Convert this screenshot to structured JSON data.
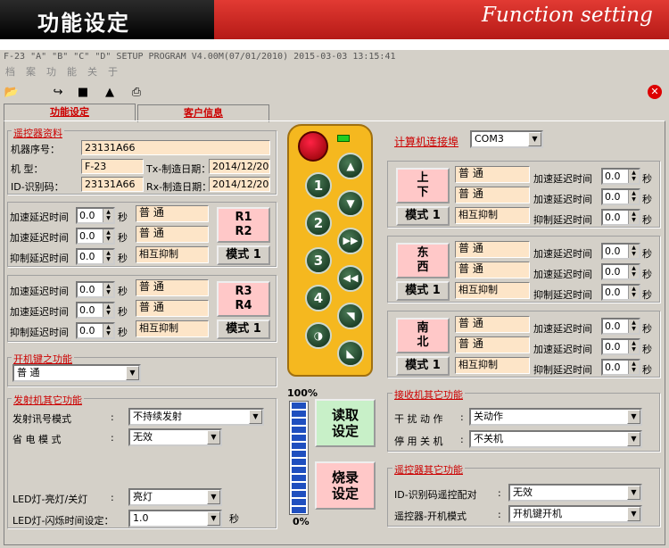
{
  "banner": {
    "title_cn": "功能设定",
    "title_en": "Function setting"
  },
  "window_title": "F-23 \"A\" \"B\" \"C\" \"D\" SETUP PROGRAM V4.00M(07/01/2010)   2015-03-03   13:15:41",
  "menu": [
    "档",
    "案",
    "功",
    "能",
    "关",
    "于"
  ],
  "toolbar_icons": [
    "open-folder-icon",
    "download-icon",
    "save-icon",
    "eject-icon",
    "print-icon",
    "close-icon"
  ],
  "tabs": [
    "功能设定",
    "客户信息"
  ],
  "controller_info": {
    "title": "遥控器资料",
    "serial_label": "机器序号：",
    "serial": "23131A66",
    "model_label": "机  型：",
    "model": "F-23",
    "tx_label": "Tx-制造日期：",
    "tx_date": "2014/12/20",
    "id_label": "ID-识别码：",
    "id": "23131A66",
    "rx_label": "Rx-制造日期：",
    "rx_date": "2014/12/20"
  },
  "left_groups": [
    {
      "rows": [
        {
          "label": "加速延迟时间",
          "value": "0.0",
          "unit": "秒",
          "mode": "普    通"
        },
        {
          "label": "加速延迟时间",
          "value": "0.0",
          "unit": "秒",
          "mode": "普    通"
        },
        {
          "label": "抑制延迟时间",
          "value": "0.0",
          "unit": "秒",
          "mode": "相互抑制"
        }
      ],
      "button": "R1\nR2",
      "mode_btn": "模式 1"
    },
    {
      "rows": [
        {
          "label": "加速延迟时间",
          "value": "0.0",
          "unit": "秒",
          "mode": "普    通"
        },
        {
          "label": "加速延迟时间",
          "value": "0.0",
          "unit": "秒",
          "mode": "普    通"
        },
        {
          "label": "抑制延迟时间",
          "value": "0.0",
          "unit": "秒",
          "mode": "相互抑制"
        }
      ],
      "button": "R3\nR4",
      "mode_btn": "模式 1"
    }
  ],
  "power_key": {
    "title": "开机键之功能",
    "value": "普   通"
  },
  "tx_other": {
    "title": "发射机其它功能",
    "signal_label": "发射讯号模式",
    "signal_value": "不持续发射",
    "power_label": "省 电 模 式",
    "power_value": "无效",
    "led_label": "LED灯-亮灯/关灯",
    "led_value": "亮灯",
    "blink_label": "LED灯-闪烁时间设定：",
    "blink_value": "1.0",
    "blink_unit": "秒",
    "colon": ":"
  },
  "com": {
    "label": "计算机连接埠",
    "value": "COM3"
  },
  "right_groups": [
    {
      "button": "上\n下",
      "mode_btn": "模式 1",
      "modes": [
        "普    通",
        "普    通",
        "相互抑制"
      ],
      "rows": [
        {
          "label": "加速延迟时间",
          "value": "0.0",
          "unit": "秒"
        },
        {
          "label": "加速延迟时间",
          "value": "0.0",
          "unit": "秒"
        },
        {
          "label": "抑制延迟时间",
          "value": "0.0",
          "unit": "秒"
        }
      ]
    },
    {
      "button": "东\n西",
      "mode_btn": "模式 1",
      "modes": [
        "普    通",
        "普    通",
        "相互抑制"
      ],
      "rows": [
        {
          "label": "加速延迟时间",
          "value": "0.0",
          "unit": "秒"
        },
        {
          "label": "加速延迟时间",
          "value": "0.0",
          "unit": "秒"
        },
        {
          "label": "抑制延迟时间",
          "value": "0.0",
          "unit": "秒"
        }
      ]
    },
    {
      "button": "南\n北",
      "mode_btn": "模式 1",
      "modes": [
        "普    通",
        "普    通",
        "相互抑制"
      ],
      "rows": [
        {
          "label": "加速延迟时间",
          "value": "0.0",
          "unit": "秒"
        },
        {
          "label": "加速延迟时间",
          "value": "0.0",
          "unit": "秒"
        },
        {
          "label": "抑制延迟时间",
          "value": "0.0",
          "unit": "秒"
        }
      ]
    }
  ],
  "remote_buttons": [
    "1",
    "2",
    "3",
    "4"
  ],
  "progress": {
    "top_label": "100%",
    "bottom_label": "0%",
    "level": 1.0
  },
  "actions": {
    "read": "读取\n设定",
    "write": "烧录\n设定"
  },
  "rx_other": {
    "title": "接收机其它功能",
    "interference_label": "干 扰 动 作",
    "interference_value": "关动作",
    "stop_label": "停 用 关 机",
    "stop_value": "不关机",
    "colon": ":"
  },
  "remote_other": {
    "title": "遥控器其它功能",
    "id_label": "ID-识别码遥控配对",
    "id_value": "无效",
    "mode_label": "遥控器-开机模式",
    "mode_value": "开机键开机",
    "colon": ":"
  },
  "colors": {
    "accent_red": "#cc0000",
    "field_bg": "#fde5c8",
    "pink_btn": "#ffc8c8",
    "green_btn": "#c8f0c8",
    "remote_body": "#f5b81f"
  }
}
